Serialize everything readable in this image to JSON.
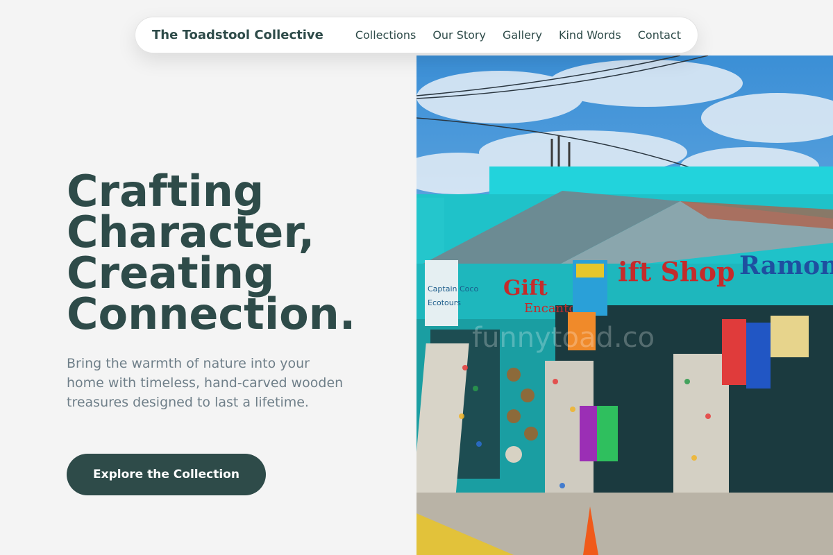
{
  "nav": {
    "brand": "The Toadstool Collective",
    "links": [
      "Collections",
      "Our Story",
      "Gallery",
      "Kind Words",
      "Contact"
    ]
  },
  "hero": {
    "title": "Crafting Character, Creating Connection.",
    "subtitle": "Bring the warmth of nature into your home with timeless, hand-carved wooden treasures designed to last a lifetime.",
    "cta_label": "Explore the Collection"
  },
  "photo": {
    "description_icon": "gift-shop-photo",
    "sign_texts": [
      "Gift Shop",
      "Ramon",
      "Captain Coco",
      "Ecotours",
      "Encanto"
    ],
    "watermark": "funnytoad.co"
  },
  "colors": {
    "primary": "#2e4b49",
    "subtitle": "#6f7f89",
    "background": "#f4f4f4",
    "shop_turquoise": "#1fc2c9"
  }
}
